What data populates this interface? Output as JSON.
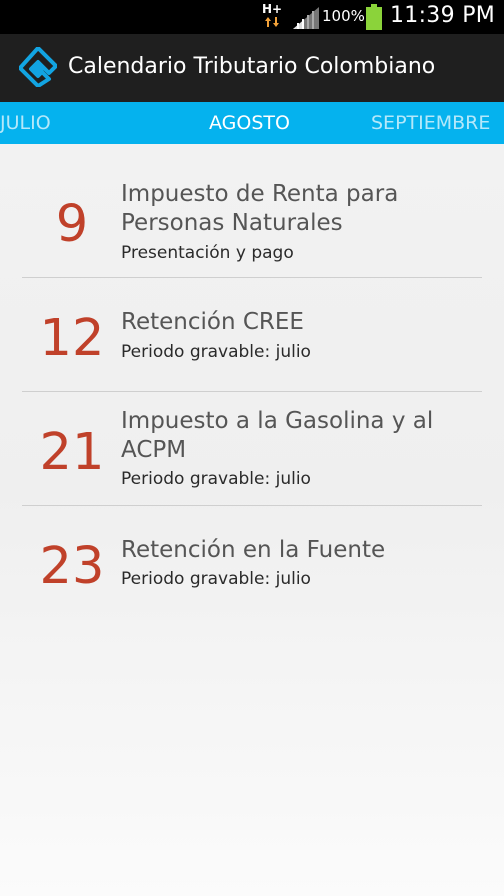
{
  "status_bar": {
    "network": "H+",
    "battery_percent": "100%",
    "time": "11:39 PM"
  },
  "action_bar": {
    "title": "Calendario Tributario Colombiano"
  },
  "tabs": {
    "previous": "JULIO",
    "current": "AGOSTO",
    "next": "SEPTIEMBRE"
  },
  "events": [
    {
      "day": "9",
      "name_line1": "Impuesto de Renta para",
      "name_line2": "Personas Naturales",
      "detail": "Presentación y pago"
    },
    {
      "day": "12",
      "name_line1": "Retención CREE",
      "name_line2": "",
      "detail": "Periodo gravable: julio"
    },
    {
      "day": "21",
      "name_line1": "Impuesto a la Gasolina y al",
      "name_line2": "ACPM",
      "detail": "Periodo gravable: julio"
    },
    {
      "day": "23",
      "name_line1": "Retención en la Fuente",
      "name_line2": "",
      "detail": "Periodo gravable: julio"
    }
  ],
  "colors": {
    "accent_tab": "#05b2ee",
    "day_number": "#c0412a",
    "action_bar": "#1f1f1f"
  },
  "icons": {
    "app_logo": "app-logo-icon",
    "signal": "signal-icon",
    "battery": "battery-icon",
    "data": "data-arrows-icon"
  }
}
